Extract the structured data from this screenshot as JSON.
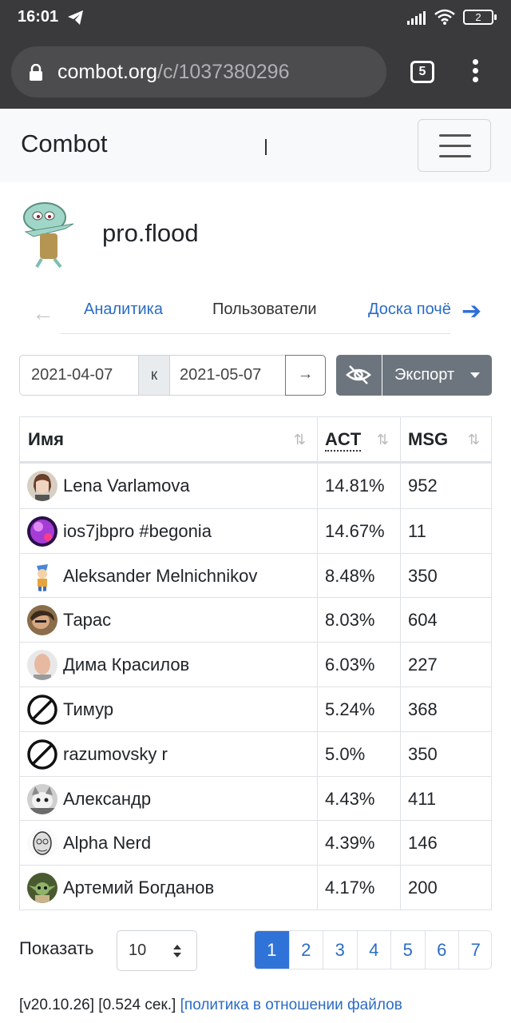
{
  "status": {
    "time": "16:01",
    "battery": "2"
  },
  "browser": {
    "url_host": "combot.org",
    "url_path": "/c/1037380296",
    "tab_count": "5"
  },
  "navbar": {
    "brand": "Combot"
  },
  "group": {
    "name": "pro.flood"
  },
  "nav": {
    "tabs": [
      {
        "label": "Аналитика"
      },
      {
        "label": "Пользователи"
      },
      {
        "label": "Доска почёта"
      }
    ]
  },
  "range": {
    "from": "2021-04-07",
    "separator": "к",
    "to": "2021-05-07",
    "go": "→",
    "export_label": "Экспорт"
  },
  "table": {
    "headers": {
      "name": "Имя",
      "act": "ACT",
      "msg": "MSG"
    },
    "rows": [
      {
        "name": "Lena Varlamova",
        "act": "14.81%",
        "msg": "952",
        "avatar": "photo-woman"
      },
      {
        "name": "ios7jbpro #begonia",
        "act": "14.67%",
        "msg": "11",
        "avatar": "purple-sphere"
      },
      {
        "name": "Aleksander Melnichnikov",
        "act": "8.48%",
        "msg": "350",
        "avatar": "cartoon-character"
      },
      {
        "name": "Тарас",
        "act": "8.03%",
        "msg": "604",
        "avatar": "photo-man"
      },
      {
        "name": "Дима Красилов",
        "act": "6.03%",
        "msg": "227",
        "avatar": "photo-bald-man"
      },
      {
        "name": "Тимур",
        "act": "5.24%",
        "msg": "368",
        "avatar": "no-photo"
      },
      {
        "name": "razumovsky r",
        "act": "5.0%",
        "msg": "350",
        "avatar": "no-photo"
      },
      {
        "name": "Александр",
        "act": "4.43%",
        "msg": "411",
        "avatar": "photo-cat"
      },
      {
        "name": "Alpha Nerd",
        "act": "4.39%",
        "msg": "146",
        "avatar": "photo-old-man"
      },
      {
        "name": "Артемий Богданов",
        "act": "4.17%",
        "msg": "200",
        "avatar": "photo-green-character"
      }
    ]
  },
  "pagination": {
    "show_label": "Показать",
    "page_size": "10",
    "pages": [
      "1",
      "2",
      "3",
      "4",
      "5",
      "6",
      "7"
    ],
    "current": "1"
  },
  "footer": {
    "version": "[v20.10.26] [0.524 сек.]",
    "link": "[политика в отношении файлов"
  },
  "colors": {
    "accent": "#3073d8",
    "link": "#2b6cc4",
    "button": "#6c757d",
    "chrome": "#3a3a3c"
  }
}
